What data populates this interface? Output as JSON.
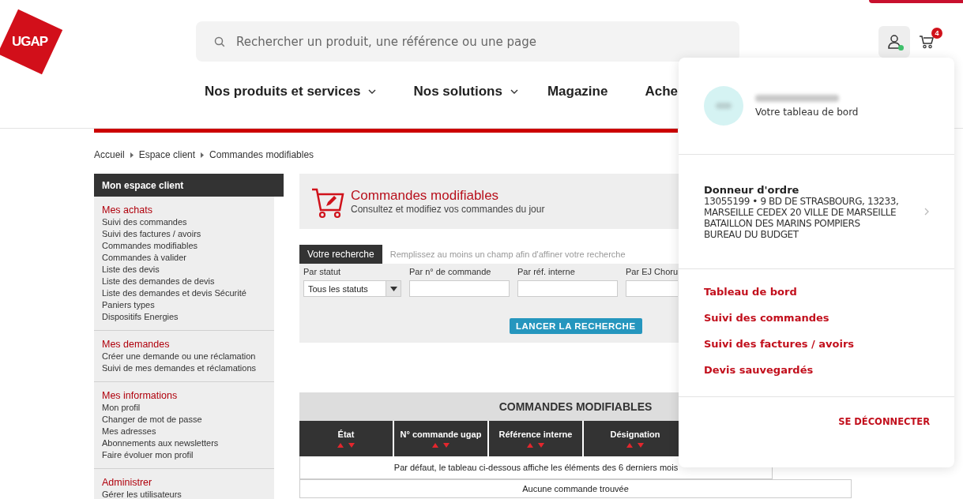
{
  "logo": {
    "text": "UGAP"
  },
  "search": {
    "placeholder": "Rechercher un produit, une référence ou une page"
  },
  "cart": {
    "count": "4"
  },
  "user": {
    "online": true
  },
  "nav": [
    {
      "label": "Nos produits et services",
      "dropdown": true
    },
    {
      "label": "Nos solutions",
      "dropdown": true
    },
    {
      "label": "Magazine",
      "dropdown": false
    },
    {
      "label": "Ache",
      "dropdown": false
    }
  ],
  "breadcrumb": [
    "Accueil",
    "Espace client",
    "Commandes modifiables"
  ],
  "sidebar": {
    "title": "Mon espace client",
    "sections": [
      {
        "heading": "Mes achats",
        "items": [
          "Suivi des commandes",
          "Suivi des factures / avoirs",
          "Commandes modifiables",
          "Commandes à valider",
          "Liste des devis",
          "Liste des demandes de devis",
          "Liste des demandes et devis Sécurité",
          "Paniers types",
          "Dispositifs Energies"
        ]
      },
      {
        "heading": "Mes demandes",
        "items": [
          "Créer une demande ou une réclamation",
          "Suivi de mes demandes et réclamations"
        ]
      },
      {
        "heading": "Mes informations",
        "items": [
          "Mon profil",
          "Changer de mot de passe",
          "Mes adresses",
          "Abonnements aux newsletters",
          "Faire évoluer mon profil"
        ]
      },
      {
        "heading": "Administrer",
        "items": [
          "Gérer les utilisateurs"
        ]
      }
    ]
  },
  "page_header": {
    "title": "Commandes modifiables",
    "subtitle": "Consultez et modifiez vos commandes du jour"
  },
  "search_form": {
    "tab": "Votre recherche",
    "hint": "Remplissez au moins un champ afin d'affiner votre recherche",
    "filters": [
      {
        "kind": "select",
        "label": "Par statut",
        "value": "Tous les statuts"
      },
      {
        "kind": "text",
        "label": "Par n° de commande"
      },
      {
        "kind": "text",
        "label": "Par réf. interne"
      },
      {
        "kind": "text",
        "label": "Par EJ Choru"
      }
    ],
    "button": "LANCER LA RECHERCHE"
  },
  "table": {
    "title": "COMMANDES MODIFIABLES",
    "columns": [
      "État",
      "N° commande ugap",
      "Référence interne",
      "Désignation"
    ],
    "note": "Par défaut, le tableau ci-dessous affiche les éléments des 6 derniers mois",
    "empty": "Aucune commande trouvée"
  },
  "account_menu": {
    "subtitle": "Votre tableau de bord",
    "orderer": {
      "heading": "Donneur d'ordre",
      "lines": [
        "13055199 • 9 BD DE STRASBOURG, 13233,",
        "MARSEILLE CEDEX 20 VILLE DE MARSEILLE",
        "BATAILLON DES MARINS POMPIERS",
        "BUREAU DU BUDGET"
      ]
    },
    "links": [
      "Tableau de bord",
      "Suivi des commandes",
      "Suivi des factures / avoirs",
      "Devis sauvegardés"
    ],
    "logout": "SE DÉCONNECTER"
  }
}
